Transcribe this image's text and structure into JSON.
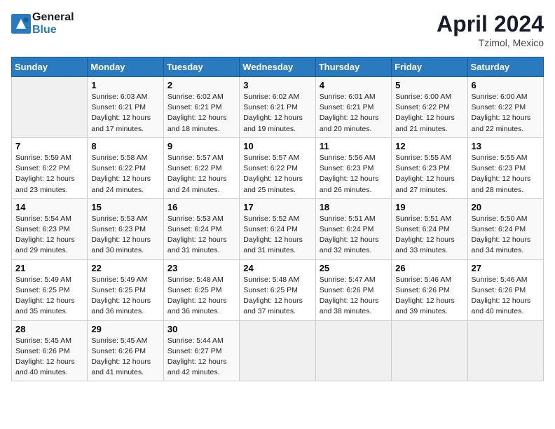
{
  "header": {
    "logo_line1": "General",
    "logo_line2": "Blue",
    "main_title": "April 2024",
    "subtitle": "Tzimol, Mexico"
  },
  "calendar": {
    "days_of_week": [
      "Sunday",
      "Monday",
      "Tuesday",
      "Wednesday",
      "Thursday",
      "Friday",
      "Saturday"
    ],
    "weeks": [
      [
        {
          "num": "",
          "info": ""
        },
        {
          "num": "1",
          "info": "Sunrise: 6:03 AM\nSunset: 6:21 PM\nDaylight: 12 hours\nand 17 minutes."
        },
        {
          "num": "2",
          "info": "Sunrise: 6:02 AM\nSunset: 6:21 PM\nDaylight: 12 hours\nand 18 minutes."
        },
        {
          "num": "3",
          "info": "Sunrise: 6:02 AM\nSunset: 6:21 PM\nDaylight: 12 hours\nand 19 minutes."
        },
        {
          "num": "4",
          "info": "Sunrise: 6:01 AM\nSunset: 6:21 PM\nDaylight: 12 hours\nand 20 minutes."
        },
        {
          "num": "5",
          "info": "Sunrise: 6:00 AM\nSunset: 6:22 PM\nDaylight: 12 hours\nand 21 minutes."
        },
        {
          "num": "6",
          "info": "Sunrise: 6:00 AM\nSunset: 6:22 PM\nDaylight: 12 hours\nand 22 minutes."
        }
      ],
      [
        {
          "num": "7",
          "info": "Sunrise: 5:59 AM\nSunset: 6:22 PM\nDaylight: 12 hours\nand 23 minutes."
        },
        {
          "num": "8",
          "info": "Sunrise: 5:58 AM\nSunset: 6:22 PM\nDaylight: 12 hours\nand 24 minutes."
        },
        {
          "num": "9",
          "info": "Sunrise: 5:57 AM\nSunset: 6:22 PM\nDaylight: 12 hours\nand 24 minutes."
        },
        {
          "num": "10",
          "info": "Sunrise: 5:57 AM\nSunset: 6:22 PM\nDaylight: 12 hours\nand 25 minutes."
        },
        {
          "num": "11",
          "info": "Sunrise: 5:56 AM\nSunset: 6:23 PM\nDaylight: 12 hours\nand 26 minutes."
        },
        {
          "num": "12",
          "info": "Sunrise: 5:55 AM\nSunset: 6:23 PM\nDaylight: 12 hours\nand 27 minutes."
        },
        {
          "num": "13",
          "info": "Sunrise: 5:55 AM\nSunset: 6:23 PM\nDaylight: 12 hours\nand 28 minutes."
        }
      ],
      [
        {
          "num": "14",
          "info": "Sunrise: 5:54 AM\nSunset: 6:23 PM\nDaylight: 12 hours\nand 29 minutes."
        },
        {
          "num": "15",
          "info": "Sunrise: 5:53 AM\nSunset: 6:23 PM\nDaylight: 12 hours\nand 30 minutes."
        },
        {
          "num": "16",
          "info": "Sunrise: 5:53 AM\nSunset: 6:24 PM\nDaylight: 12 hours\nand 31 minutes."
        },
        {
          "num": "17",
          "info": "Sunrise: 5:52 AM\nSunset: 6:24 PM\nDaylight: 12 hours\nand 31 minutes."
        },
        {
          "num": "18",
          "info": "Sunrise: 5:51 AM\nSunset: 6:24 PM\nDaylight: 12 hours\nand 32 minutes."
        },
        {
          "num": "19",
          "info": "Sunrise: 5:51 AM\nSunset: 6:24 PM\nDaylight: 12 hours\nand 33 minutes."
        },
        {
          "num": "20",
          "info": "Sunrise: 5:50 AM\nSunset: 6:24 PM\nDaylight: 12 hours\nand 34 minutes."
        }
      ],
      [
        {
          "num": "21",
          "info": "Sunrise: 5:49 AM\nSunset: 6:25 PM\nDaylight: 12 hours\nand 35 minutes."
        },
        {
          "num": "22",
          "info": "Sunrise: 5:49 AM\nSunset: 6:25 PM\nDaylight: 12 hours\nand 36 minutes."
        },
        {
          "num": "23",
          "info": "Sunrise: 5:48 AM\nSunset: 6:25 PM\nDaylight: 12 hours\nand 36 minutes."
        },
        {
          "num": "24",
          "info": "Sunrise: 5:48 AM\nSunset: 6:25 PM\nDaylight: 12 hours\nand 37 minutes."
        },
        {
          "num": "25",
          "info": "Sunrise: 5:47 AM\nSunset: 6:26 PM\nDaylight: 12 hours\nand 38 minutes."
        },
        {
          "num": "26",
          "info": "Sunrise: 5:46 AM\nSunset: 6:26 PM\nDaylight: 12 hours\nand 39 minutes."
        },
        {
          "num": "27",
          "info": "Sunrise: 5:46 AM\nSunset: 6:26 PM\nDaylight: 12 hours\nand 40 minutes."
        }
      ],
      [
        {
          "num": "28",
          "info": "Sunrise: 5:45 AM\nSunset: 6:26 PM\nDaylight: 12 hours\nand 40 minutes."
        },
        {
          "num": "29",
          "info": "Sunrise: 5:45 AM\nSunset: 6:26 PM\nDaylight: 12 hours\nand 41 minutes."
        },
        {
          "num": "30",
          "info": "Sunrise: 5:44 AM\nSunset: 6:27 PM\nDaylight: 12 hours\nand 42 minutes."
        },
        {
          "num": "",
          "info": ""
        },
        {
          "num": "",
          "info": ""
        },
        {
          "num": "",
          "info": ""
        },
        {
          "num": "",
          "info": ""
        }
      ]
    ]
  }
}
